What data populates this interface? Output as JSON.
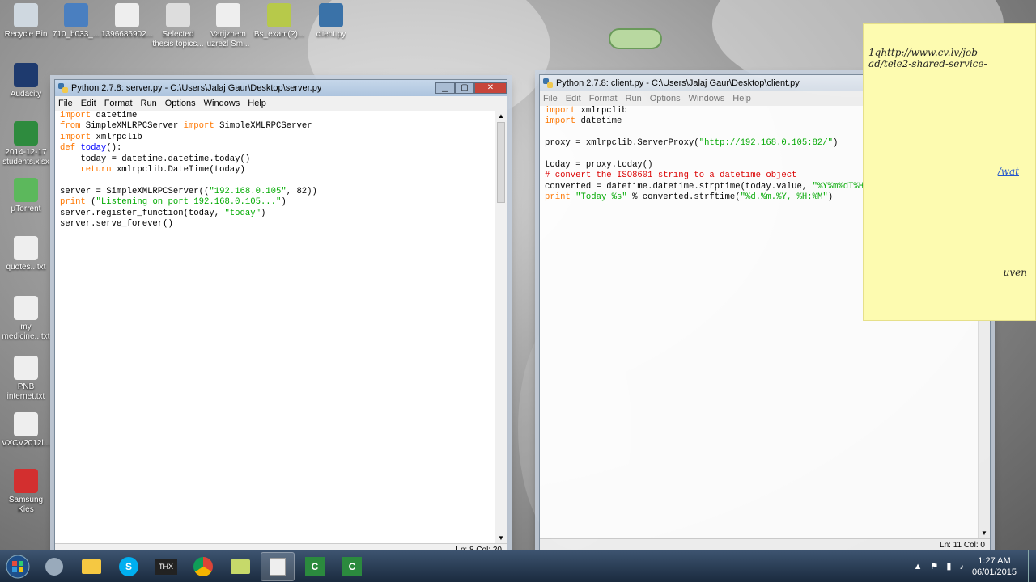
{
  "desktop": {
    "icons": [
      {
        "label": "Recycle Bin"
      },
      {
        "label": "710_b033_..."
      },
      {
        "label": "1396686902..."
      },
      {
        "label": "Selected thesis topics..."
      },
      {
        "label": "Varijznem uzrezl Sm..."
      },
      {
        "label": "Bs_exam(?)..."
      },
      {
        "label": "client.py"
      },
      {
        "label": "Audacity"
      },
      {
        "label": "2014-12-17 students.xlsx"
      },
      {
        "label": "µTorrent"
      },
      {
        "label": "quotes...txt"
      },
      {
        "label": "my medicine...txt"
      },
      {
        "label": "PNB internet.txt"
      },
      {
        "label": "VXCV2012l..."
      },
      {
        "label": "Samsung Kies"
      }
    ]
  },
  "server_window": {
    "title": "Python 2.7.8: server.py - C:\\Users\\Jalaj Gaur\\Desktop\\server.py",
    "menu": [
      "File",
      "Edit",
      "Format",
      "Run",
      "Options",
      "Windows",
      "Help"
    ],
    "status": "Ln: 8 Col: 20",
    "lines": [
      [
        {
          "t": "import",
          "c": "kw"
        },
        {
          "t": " datetime"
        }
      ],
      [
        {
          "t": "from",
          "c": "kw"
        },
        {
          "t": " SimpleXMLRPCServer "
        },
        {
          "t": "import",
          "c": "kw"
        },
        {
          "t": " SimpleXMLRPCServer"
        }
      ],
      [
        {
          "t": "import",
          "c": "kw"
        },
        {
          "t": " xmlrpclib"
        }
      ],
      [
        {
          "t": "def",
          "c": "kw"
        },
        {
          "t": " "
        },
        {
          "t": "today",
          "c": "def"
        },
        {
          "t": "():"
        }
      ],
      [
        {
          "t": "    today = datetime.datetime.today()"
        }
      ],
      [
        {
          "t": "    "
        },
        {
          "t": "return",
          "c": "kw"
        },
        {
          "t": " xmlrpclib.DateTime(today)"
        }
      ],
      [
        {
          "t": ""
        }
      ],
      [
        {
          "t": "server = SimpleXMLRPCServer(("
        },
        {
          "t": "\"192.168.0.105\"",
          "c": "str"
        },
        {
          "t": ", 82))"
        }
      ],
      [
        {
          "t": "print",
          "c": "kw"
        },
        {
          "t": " ("
        },
        {
          "t": "\"Listening on port 192.168.0.105...\"",
          "c": "str"
        },
        {
          "t": ")"
        }
      ],
      [
        {
          "t": "server.register_function(today, "
        },
        {
          "t": "\"today\"",
          "c": "str"
        },
        {
          "t": ")"
        }
      ],
      [
        {
          "t": "server.serve_forever()"
        }
      ]
    ]
  },
  "client_window": {
    "title": "Python 2.7.8: client.py - C:\\Users\\Jalaj Gaur\\Desktop\\client.py",
    "menu": [
      "File",
      "Edit",
      "Format",
      "Run",
      "Options",
      "Windows",
      "Help"
    ],
    "status": "Ln: 11 Col: 0",
    "lines": [
      [
        {
          "t": "import",
          "c": "kw"
        },
        {
          "t": " xmlrpclib"
        }
      ],
      [
        {
          "t": "import",
          "c": "kw"
        },
        {
          "t": " datetime"
        }
      ],
      [
        {
          "t": ""
        }
      ],
      [
        {
          "t": "proxy = xmlrpclib.ServerProxy("
        },
        {
          "t": "\"http://192.168.0.105:82/\"",
          "c": "str"
        },
        {
          "t": ")"
        }
      ],
      [
        {
          "t": ""
        }
      ],
      [
        {
          "t": "today = proxy.today()"
        }
      ],
      [
        {
          "t": "# convert the ISO8601 string to a datetime object",
          "c": "cmt"
        }
      ],
      [
        {
          "t": "converted = datetime.datetime.strptime(today.value, "
        },
        {
          "t": "\"%Y%m%dT%H:%M:%S\"",
          "c": "str"
        },
        {
          "t": ")"
        }
      ],
      [
        {
          "t": "print",
          "c": "kw"
        },
        {
          "t": " "
        },
        {
          "t": "\"Today %s\"",
          "c": "str"
        },
        {
          "t": " % converted.strftime("
        },
        {
          "t": "\"%d.%m.%Y, %H:%M\"",
          "c": "str"
        },
        {
          "t": ")"
        }
      ]
    ]
  },
  "sticky_note": {
    "lines": [
      "1qhttp://www.cv.lv/job-",
      "ad/tele2-shared-service-",
      "...",
      "/wat",
      "uven"
    ]
  },
  "taskbar": {
    "clock_time": "1:27 AM",
    "clock_date": "06/01/2015",
    "items": [
      "start-orb",
      "network-icon",
      "explorer",
      "skype",
      "thx",
      "chrome",
      "folder",
      "idle",
      "camtasia",
      "camtasia2"
    ]
  }
}
